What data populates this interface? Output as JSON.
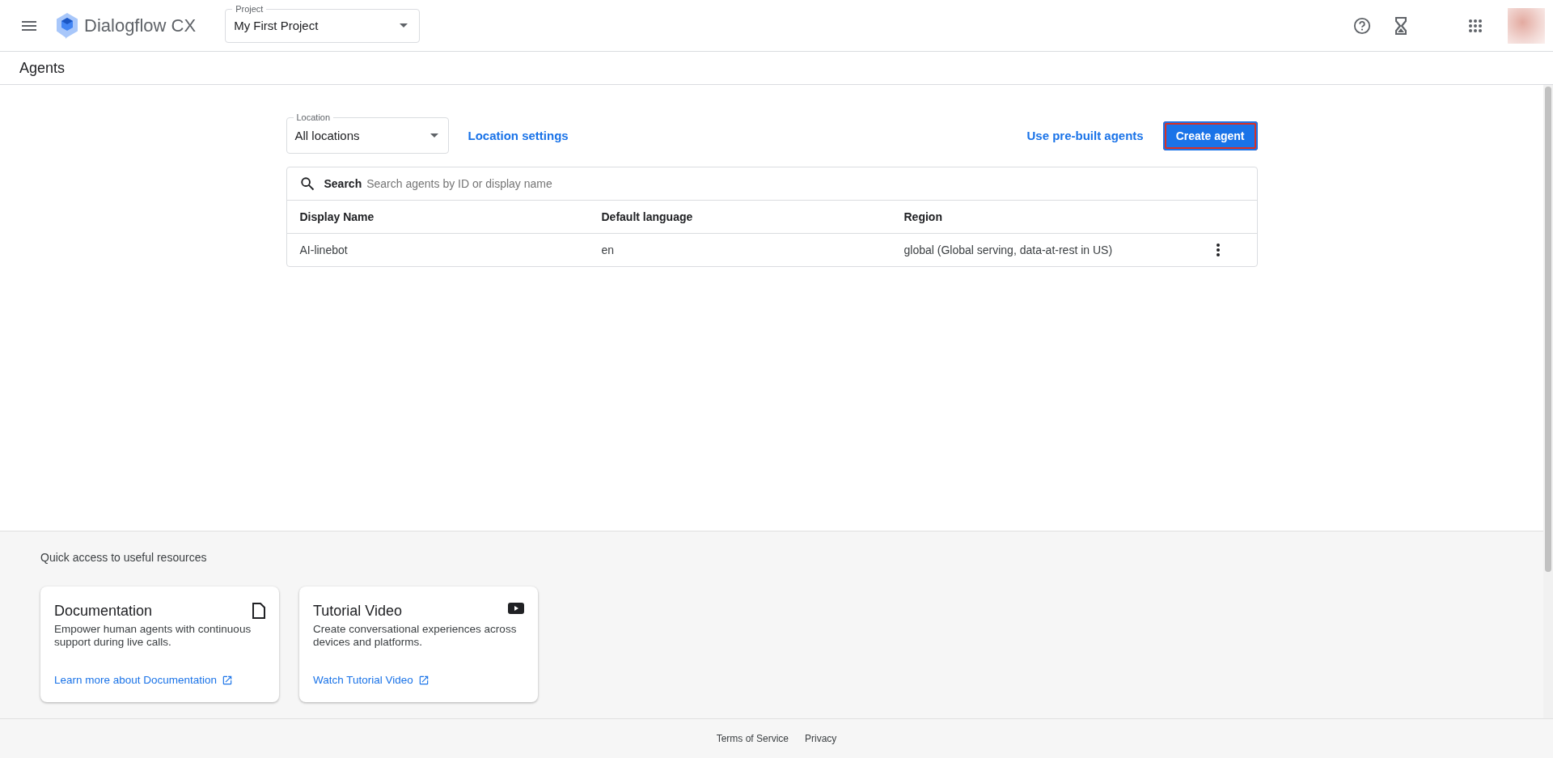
{
  "top_bar": {
    "product": "Dialogflow CX",
    "project": {
      "label": "Project",
      "value": "My First Project"
    }
  },
  "page_title": "Agents",
  "toolbar": {
    "location": {
      "label": "Location",
      "value": "All locations"
    },
    "location_settings": "Location settings",
    "prebuilt": "Use pre-built agents",
    "create": {
      "label": "Create agent",
      "outlined": true
    }
  },
  "search": {
    "label": "Search",
    "placeholder": "Search agents by ID or display name"
  },
  "table": {
    "columns": [
      "Display Name",
      "Default language",
      "Region"
    ],
    "rows": [
      {
        "cells": [
          "AI-linebot",
          "en",
          "global (Global serving, data-at-rest in US)"
        ]
      }
    ]
  },
  "resources": {
    "title": "Quick access to useful resources",
    "cards": [
      {
        "kind": "doc",
        "title": "Documentation",
        "text": "Empower human agents with continuous support during live calls.",
        "link": "Learn more about Documentation"
      },
      {
        "kind": "video",
        "title": "Tutorial Video",
        "text": "Create conversational experiences across devices and platforms.",
        "link": "Watch Tutorial Video"
      }
    ]
  },
  "footer": [
    "Terms of Service",
    "Privacy"
  ]
}
